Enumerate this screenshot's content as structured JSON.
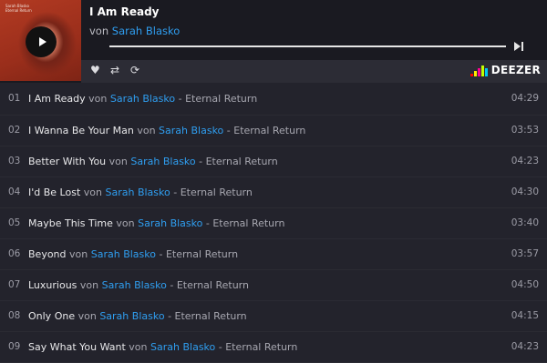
{
  "player": {
    "cover_text": [
      "Sarah Blasko",
      "Eternal Return"
    ],
    "title": "I Am Ready",
    "by": "von",
    "artist": "Sarah Blasko",
    "progress": 0.0,
    "logo_text": "DEEZER",
    "logo_colors": [
      "#ff0000",
      "#ffed00",
      "#ff0092",
      "#c2ff00",
      "#00c7f2"
    ]
  },
  "tracks": [
    {
      "num": "01",
      "title": "I Am Ready",
      "von": "von",
      "artist": "Sarah Blasko",
      "album": "- Eternal Return",
      "duration": "04:29"
    },
    {
      "num": "02",
      "title": "I Wanna Be Your Man",
      "von": "von",
      "artist": "Sarah Blasko",
      "album": "- Eternal Return",
      "duration": "03:53"
    },
    {
      "num": "03",
      "title": "Better With You",
      "von": "von",
      "artist": "Sarah Blasko",
      "album": "- Eternal Return",
      "duration": "04:23"
    },
    {
      "num": "04",
      "title": "I'd Be Lost",
      "von": "von",
      "artist": "Sarah Blasko",
      "album": "- Eternal Return",
      "duration": "04:30"
    },
    {
      "num": "05",
      "title": "Maybe This Time",
      "von": "von",
      "artist": "Sarah Blasko",
      "album": "- Eternal Return",
      "duration": "03:40"
    },
    {
      "num": "06",
      "title": "Beyond",
      "von": "von",
      "artist": "Sarah Blasko",
      "album": "- Eternal Return",
      "duration": "03:57"
    },
    {
      "num": "07",
      "title": "Luxurious",
      "von": "von",
      "artist": "Sarah Blasko",
      "album": "- Eternal Return",
      "duration": "04:50"
    },
    {
      "num": "08",
      "title": "Only One",
      "von": "von",
      "artist": "Sarah Blasko",
      "album": "- Eternal Return",
      "duration": "04:15"
    },
    {
      "num": "09",
      "title": "Say What You Want",
      "von": "von",
      "artist": "Sarah Blasko",
      "album": "- Eternal Return",
      "duration": "04:23"
    }
  ]
}
